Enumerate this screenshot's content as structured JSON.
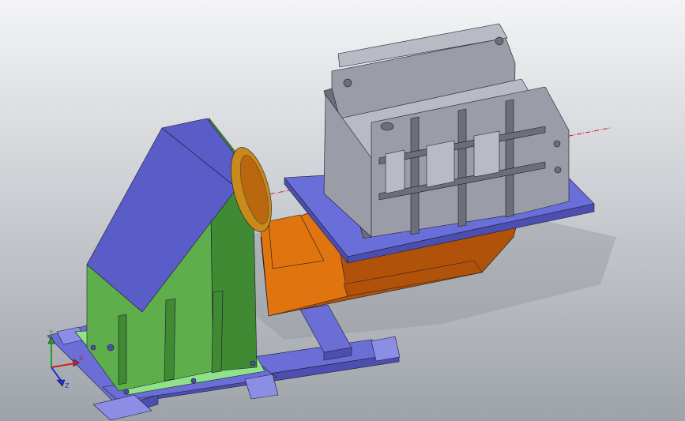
{
  "viewport": {
    "background_top": "#f3f4f6",
    "background_bottom": "#9ea3aa",
    "icon": "3d-model-view"
  },
  "model": {
    "colors": {
      "base_frame": "#6b6ed6",
      "base_frame_dark": "#4c4fb0",
      "base_frame_light": "#8c8ee6",
      "pedestal_green": "#5fae4c",
      "pedestal_green_dark": "#3f8a33",
      "pedestal_top": "#5a5cc8",
      "mount_plate_green": "#8fe28a",
      "faceplate_orange": "#c88a1a",
      "arm_orange": "#e0740f",
      "arm_orange_dark": "#b0520a",
      "table_blue": "#6a6ed8",
      "fixture_gray": "#9a9ca8",
      "fixture_gray_dark": "#6c6e78",
      "fixture_gray_light": "#b8bac4",
      "axis_line": "#d01818",
      "shadow": "#8a8e95"
    }
  },
  "triad": {
    "x_label": "X",
    "y_label": "Y",
    "z_label": "Z",
    "x_color": "#d02020",
    "y_color": "#20a020",
    "z_color": "#2030d0"
  }
}
